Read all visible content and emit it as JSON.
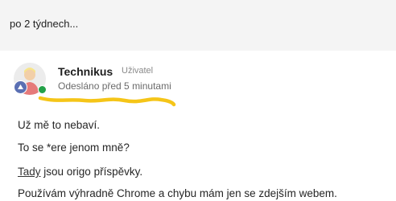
{
  "previous_post": {
    "text": "po 2 týdnech..."
  },
  "post": {
    "author": "Technikus",
    "role": "Uživatel",
    "time": "Odesláno před 5 minutami",
    "status_color": "#24a148",
    "lines": [
      {
        "text": "Už mě to nebaví."
      },
      {
        "text": "To se *ere jenom mně?"
      },
      {
        "link": "Tady",
        "text": " jsou origo příspěvky."
      },
      {
        "text": "Používám výhradně Chrome a chybu mám jen se zdejším webem."
      }
    ]
  },
  "annotation": {
    "color": "#f5c518"
  }
}
